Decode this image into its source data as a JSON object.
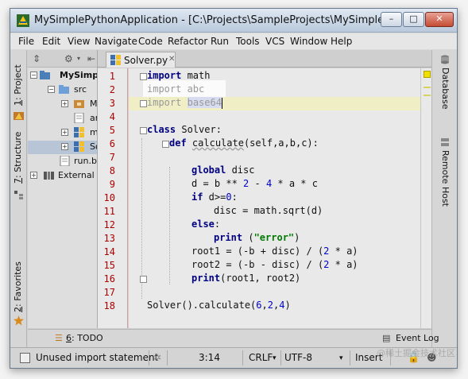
{
  "window": {
    "title": "MySimplePythonApplication - [C:\\Projects\\SampleProjects\\MySimplePythonA...",
    "min_label": "–",
    "max_label": "□",
    "close_label": "✕"
  },
  "menu": [
    "File",
    "Edit",
    "View",
    "Navigate",
    "Code",
    "Refactor",
    "Run",
    "Tools",
    "VCS",
    "Window",
    "Help"
  ],
  "left_tabs": {
    "project": {
      "num": "1",
      "label": ": Project"
    },
    "structure": {
      "num": "7",
      "label": ": Structure"
    },
    "favorites": {
      "num": "2",
      "label": ": Favorites"
    }
  },
  "right_tabs": {
    "database": "Database",
    "remote_host": "Remote Host"
  },
  "project_tree": [
    {
      "label": "MySimpleP",
      "bold": true,
      "expander": "−",
      "level": 0
    },
    {
      "label": "src",
      "expander": "−",
      "level": 1
    },
    {
      "label": "MyP",
      "expander": "+",
      "level": 2
    },
    {
      "label": "anag",
      "expander": "",
      "level": 3
    },
    {
      "label": "myP",
      "expander": "+",
      "level": 2
    },
    {
      "label": "Solv",
      "expander": "+",
      "level": 2,
      "selected": true
    },
    {
      "label": "run.bash",
      "expander": "",
      "level": 1
    },
    {
      "label": "External Libr",
      "expander": "+",
      "level": 0
    }
  ],
  "editor": {
    "tab_label": "Solver.py",
    "line_numbers": [
      "1",
      "2",
      "3",
      "4",
      "5",
      "6",
      "7",
      "8",
      "9",
      "10",
      "11",
      "12",
      "13",
      "14",
      "15",
      "16",
      "17",
      "18"
    ],
    "cursor_position": "3:14"
  },
  "bottom_tools": {
    "todo_num": "6",
    "todo_label": ": TODO",
    "event_log": "Event Log"
  },
  "status": {
    "message": "Unused import statement",
    "position": "3:14",
    "line_sep": "CRLF",
    "encoding": "UTF-8",
    "mode": "Insert"
  },
  "watermark": "@稀土掘金技术社区",
  "colors": {
    "keyword": "#000080",
    "number": "#0000cc",
    "string": "#007a00",
    "error_line_numbers": "#aa0000",
    "highlight": "#f0eec4"
  }
}
